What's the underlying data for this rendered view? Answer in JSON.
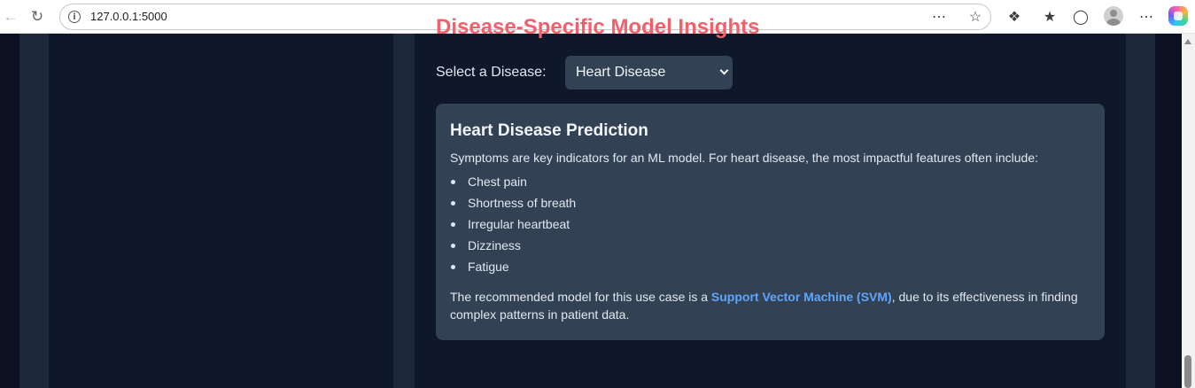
{
  "browser": {
    "url": "127.0.0.1:5000",
    "icons": {
      "back": "arrow-left-icon",
      "reload": "reload-icon",
      "site_info": "info-icon",
      "read_aloud": "more-circle-icon",
      "favorite": "star-icon",
      "extensions": "puzzle-icon",
      "favorites": "favorites-list-icon",
      "browser_essentials": "shield-icon",
      "profile": "avatar-icon",
      "menu": "ellipsis-icon",
      "copilot": "copilot-icon"
    }
  },
  "section": {
    "heading": "Disease-Specific Model Insights",
    "select_label": "Select a Disease:",
    "selected_disease": "Heart Disease"
  },
  "card": {
    "title": "Heart Disease Prediction",
    "intro": "Symptoms are key indicators for an ML model. For heart disease, the most impactful features often include:",
    "symptoms": [
      "Chest pain",
      "Shortness of breath",
      "Irregular heartbeat",
      "Dizziness",
      "Fatigue"
    ],
    "footer_before": "The recommended model for this use case is a ",
    "model_name": "Support Vector Machine (SVM)",
    "footer_after": ", due to its effectiveness in finding complex patterns in patient data."
  },
  "colors": {
    "page_background": "#0b1120",
    "panel_background": "#0f172a",
    "outer_column": "#1d293b",
    "card_background": "#334155",
    "heading_accent": "#f35f6a",
    "model_highlight": "#60a5fa",
    "text": "#e2e8f0"
  }
}
